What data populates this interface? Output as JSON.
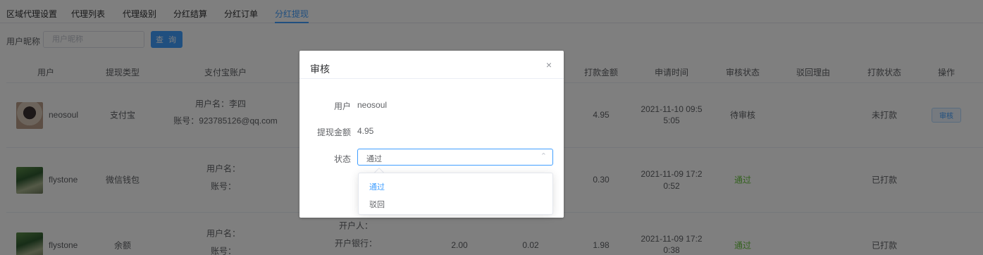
{
  "tabs": [
    "区域代理设置",
    "代理列表",
    "代理级别",
    "分红结算",
    "分红订单",
    "分红提现"
  ],
  "search": {
    "label": "用户昵称",
    "placeholder": "用户昵称",
    "button": "查 询"
  },
  "table": {
    "headers": [
      "用户",
      "提现类型",
      "支付宝账户",
      "打款金额",
      "申请时间",
      "审核状态",
      "驳回理由",
      "打款状态",
      "操作"
    ],
    "rows": [
      {
        "user": "neosoul",
        "type": "支付宝",
        "account_name": "用户名：李四",
        "account_no": "账号：923785126@qq.com",
        "amount": "4.95",
        "time1": "2021-11-10 09:5",
        "time2": "5:05",
        "audit": "待审核",
        "reason": "",
        "pay_status": "未打款",
        "action": "审核"
      },
      {
        "user": "flystone",
        "type": "微信钱包",
        "account_name": "用户名：",
        "account_no": "账号：",
        "amount": "0.30",
        "time1": "2021-11-09 17:2",
        "time2": "0:52",
        "audit": "通过",
        "reason": "",
        "pay_status": "已打款"
      },
      {
        "user": "flystone",
        "type": "余额",
        "account_name": "用户名：",
        "account_no": "账号：",
        "bank_holder": "开户人：",
        "bank_name": "开户银行：",
        "col_a": "2.00",
        "col_b": "0.02",
        "amount": "1.98",
        "time1": "2021-11-09 17:2",
        "time2": "0:38",
        "audit": "通过",
        "reason": "",
        "pay_status": "已打款"
      }
    ]
  },
  "dialog": {
    "title": "审核",
    "close": "×",
    "user_label": "用户",
    "user_value": "neosoul",
    "amount_label": "提现金额",
    "amount_value": "4.95",
    "status_label": "状态",
    "status_value": "通过",
    "options": [
      "通过",
      "驳回"
    ]
  },
  "colors": {
    "accent": "#409eff",
    "success": "#67c23a",
    "overlay": "rgba(0,0,0,0.5)"
  }
}
